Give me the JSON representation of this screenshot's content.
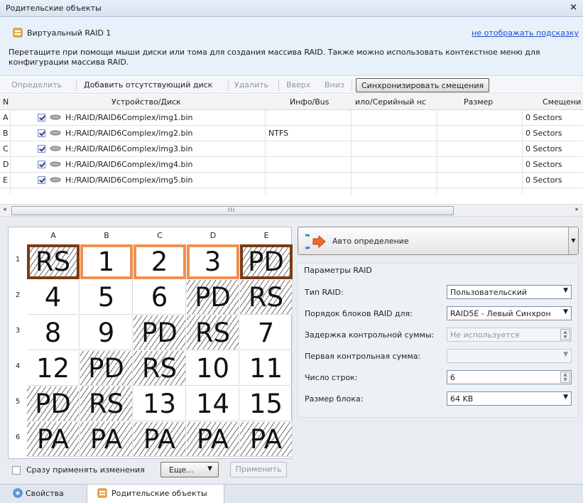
{
  "window": {
    "title": "Родительские объекты",
    "close_glyph": "×"
  },
  "hint": {
    "object_name": "Виртуальный RAID 1",
    "hide_link": "не отображать подсказку",
    "message": "Перетащите при помощи мыши диски или тома для создания массива RAID. Также можно использовать контекстное меню для конфигурации массива RAID."
  },
  "toolbar": {
    "detect": "Определить",
    "add_missing": "Добавить отсутствующий диск",
    "delete": "Удалить",
    "up": "Вверх",
    "down": "Вниз",
    "sync_offsets": "Синхронизировать смещения"
  },
  "grid": {
    "columns": [
      "N",
      "Устройство/Диск",
      "Инфо/Bus",
      "ило/Серийный нс",
      "Размер",
      "Смещени"
    ],
    "rows": [
      {
        "n": "A",
        "device": "H:/RAID/RAID6Complex/img1.bin",
        "info": "",
        "serial": "",
        "size": "",
        "offset": "0 Sectors"
      },
      {
        "n": "B",
        "device": "H:/RAID/RAID6Complex/img2.bin",
        "info": "NTFS",
        "serial": "",
        "size": "",
        "offset": "0 Sectors"
      },
      {
        "n": "C",
        "device": "H:/RAID/RAID6Complex/img3.bin",
        "info": "",
        "serial": "",
        "size": "",
        "offset": "0 Sectors"
      },
      {
        "n": "D",
        "device": "H:/RAID/RAID6Complex/img4.bin",
        "info": "",
        "serial": "",
        "size": "",
        "offset": "0 Sectors"
      },
      {
        "n": "E",
        "device": "H:/RAID/RAID6Complex/img5.bin",
        "info": "",
        "serial": "",
        "size": "",
        "offset": "0 Sectors"
      }
    ]
  },
  "scroll": {
    "left_glyph": "◂",
    "right_glyph": "▸",
    "thumb_glyph": "III"
  },
  "matrix": {
    "columns": [
      "A",
      "B",
      "C",
      "D",
      "E"
    ],
    "rows": [
      {
        "n": "1",
        "cells": [
          "RS",
          "1",
          "2",
          "3",
          "PD"
        ]
      },
      {
        "n": "2",
        "cells": [
          "4",
          "5",
          "6",
          "PD",
          "RS"
        ]
      },
      {
        "n": "3",
        "cells": [
          "8",
          "9",
          "PD",
          "RS",
          "7"
        ]
      },
      {
        "n": "4",
        "cells": [
          "12",
          "PD",
          "RS",
          "10",
          "11"
        ]
      },
      {
        "n": "5",
        "cells": [
          "PD",
          "RS",
          "13",
          "14",
          "15"
        ]
      },
      {
        "n": "6",
        "cells": [
          "PA",
          "PA",
          "PA",
          "PA",
          "PA"
        ]
      }
    ]
  },
  "auto_detect": {
    "label": "Авто определение"
  },
  "raid_params": {
    "title": "Параметры RAID",
    "fields": [
      {
        "label": "Тип RAID:",
        "value": "Пользовательский"
      },
      {
        "label": "Порядок блоков RAID для:",
        "value": "RAID5E - Левый Синхрон"
      },
      {
        "label": "Задержка контрольной суммы:",
        "value": "Не используется"
      },
      {
        "label": "Первая контрольная сумма:",
        "value": ""
      },
      {
        "label": "Число строк:",
        "value": "6"
      },
      {
        "label": "Размер блока:",
        "value": "64 KB"
      }
    ]
  },
  "footer": {
    "apply_immediately": "Сразу применять изменения",
    "more": "Еще...",
    "apply": "Применить"
  },
  "tabs": [
    {
      "label": "Свойства"
    },
    {
      "label": "Родительские объекты"
    }
  ],
  "colors": {
    "selected_border": "#ef9050",
    "selected_dark_border": "#7b3a14",
    "link": "#1a4fd6"
  }
}
